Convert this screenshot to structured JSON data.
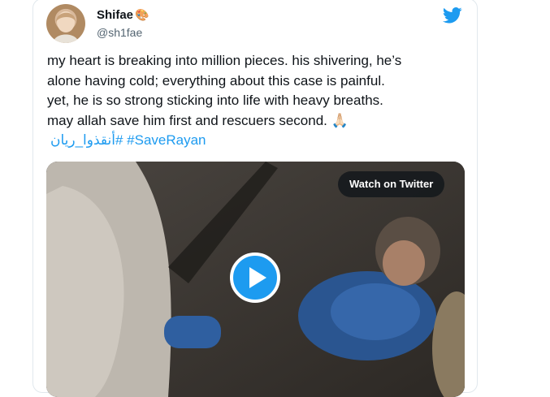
{
  "tweet": {
    "author_name": "Shifae",
    "author_emoji": "🎨",
    "author_handle": "@sh1fae",
    "text_lines": [
      "my heart is breaking into million pieces. his shivering, he’s",
      "alone having cold; everything about this case is painful.",
      "yet, he is so strong sticking into life with heavy breaths.",
      "may allah save him first and rescuers second. 🙏🏻"
    ],
    "hashtags": [
      "#أنقذوا_ريان",
      "#SaveRayan"
    ]
  },
  "media": {
    "watch_label": "Watch on Twitter"
  },
  "colors": {
    "accent": "#1d9bf0",
    "text": "#0f1419",
    "secondary": "#536471",
    "border": "#e1e8ed"
  },
  "icons": {
    "twitter": "twitter-bird-icon",
    "play": "play-icon"
  }
}
